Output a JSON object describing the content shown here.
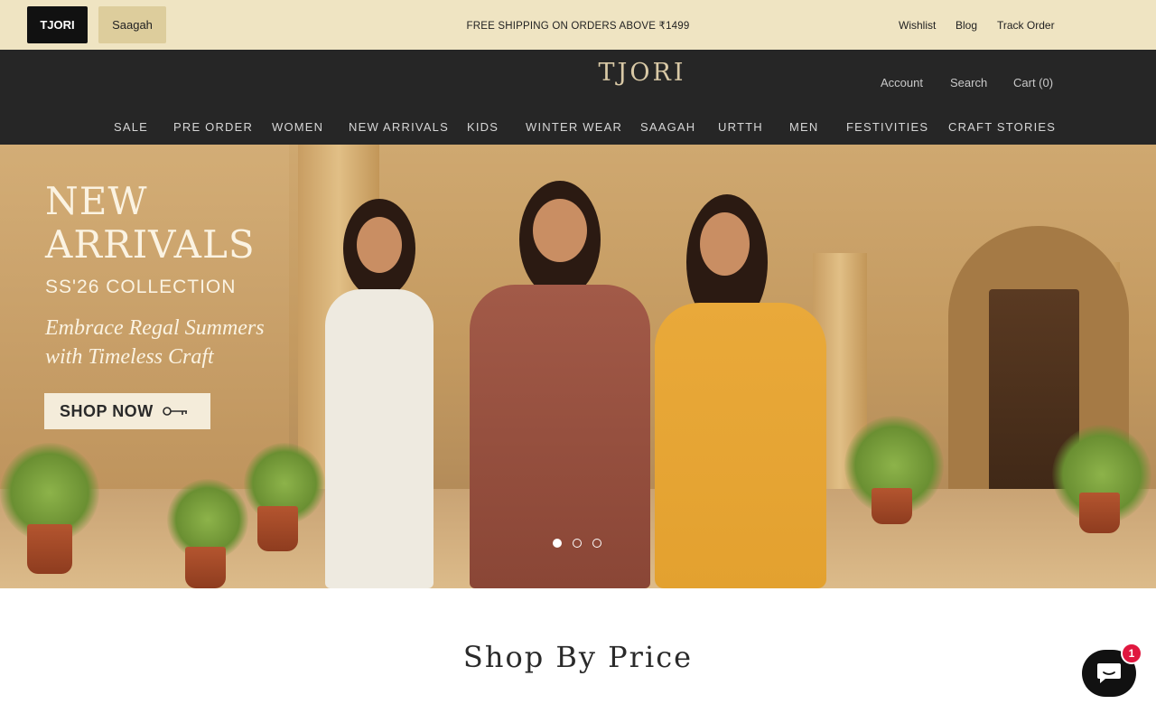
{
  "topbar": {
    "store_tabs": [
      {
        "label": "TJORI"
      },
      {
        "label": "Saagah"
      }
    ],
    "announcement": "FREE SHIPPING ON ORDERS ABOVE ₹1499",
    "links": [
      {
        "label": "Wishlist"
      },
      {
        "label": "Blog"
      },
      {
        "label": "Track Order"
      }
    ]
  },
  "header": {
    "logo": "TJORI",
    "account_label": "Account",
    "search_label": "Search",
    "cart_label": "Cart (0)",
    "nav": [
      {
        "label": "SALE"
      },
      {
        "label": "PRE ORDER"
      },
      {
        "label": "WOMEN"
      },
      {
        "label": "NEW ARRIVALS"
      },
      {
        "label": "KIDS"
      },
      {
        "label": "WINTER WEAR"
      },
      {
        "label": "SAAGAH"
      },
      {
        "label": "URTTH"
      },
      {
        "label": "MEN"
      },
      {
        "label": "FESTIVITIES"
      },
      {
        "label": "CRAFT STORIES"
      }
    ]
  },
  "hero": {
    "title_line1": "NEW",
    "title_line2": "ARRIVALS",
    "subtitle": "SS'26 COLLECTION",
    "tagline_line1": "Embrace Regal Summers",
    "tagline_line2": "with Timeless Craft",
    "cta_label": "SHOP NOW",
    "slides_total": 3,
    "active_slide": 1
  },
  "shop_by_price": {
    "title": "Shop By Price"
  },
  "chat": {
    "unread_count": "1",
    "icon": "chat-bubble-icon"
  },
  "colors": {
    "topbar_bg": "#efe4c2",
    "header_bg": "#262626",
    "logo_gold": "#d9c9a6",
    "badge_red": "#e0173f"
  }
}
